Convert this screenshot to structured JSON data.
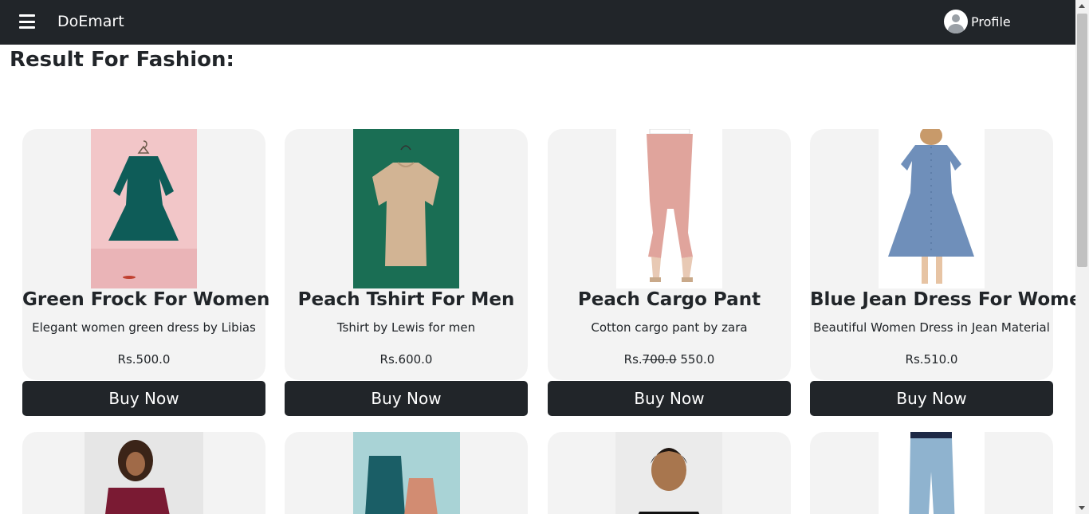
{
  "navbar": {
    "brand": "DoEmart",
    "profile_label": "Profile"
  },
  "page": {
    "title": "Result For Fashion:"
  },
  "products": [
    {
      "title": "Green Frock For Women",
      "description": "Elegant women green dress by Libias",
      "price_prefix": "Rs.",
      "price": "500.0",
      "old_price": "",
      "button": "Buy Now",
      "image": "green-frock-image"
    },
    {
      "title": "Peach Tshirt For Men",
      "description": "Tshirt by Lewis for men",
      "price_prefix": "Rs.",
      "price": "600.0",
      "old_price": "",
      "button": "Buy Now",
      "image": "peach-tshirt-image"
    },
    {
      "title": "Peach Cargo Pant",
      "description": "Cotton cargo pant by zara",
      "price_prefix": "Rs.",
      "price": "550.0",
      "old_price": "700.0",
      "button": "Buy Now",
      "image": "peach-cargo-image"
    },
    {
      "title": "Blue Jean Dress For Women",
      "description": "Beautiful Women Dress in Jean Material",
      "price_prefix": "Rs.",
      "price": "510.0",
      "old_price": "",
      "button": "Buy Now",
      "image": "blue-jean-dress-image"
    }
  ],
  "colors": {
    "navbar": "#212529",
    "card_bg": "#f3f3f3",
    "button_bg": "#212529"
  }
}
